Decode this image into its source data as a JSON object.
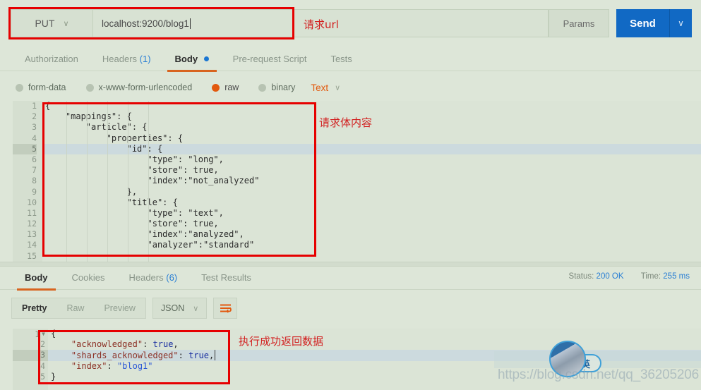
{
  "request_bar": {
    "method": "PUT",
    "method_caret": "∨",
    "url_value": "localhost:9200/blog1",
    "params_label": "Params",
    "send_label": "Send",
    "send_caret": "∨",
    "annotation": "请求url"
  },
  "request_tabs": [
    {
      "label": "Authorization",
      "active": false
    },
    {
      "label": "Headers",
      "count": "(1)",
      "active": false
    },
    {
      "label": "Body",
      "dot": true,
      "active": true
    },
    {
      "label": "Pre-request Script",
      "active": false
    },
    {
      "label": "Tests",
      "active": false
    }
  ],
  "body_types": [
    {
      "label": "form-data",
      "selected": false
    },
    {
      "label": "x-www-form-urlencoded",
      "selected": false
    },
    {
      "label": "raw",
      "selected": true
    },
    {
      "label": "binary",
      "selected": false
    }
  ],
  "body_format": {
    "label": "Text",
    "caret": "∨"
  },
  "request_body": {
    "annotation": "请求体内容",
    "active_line": 5,
    "lines": [
      "{",
      "    \"mappings\": {",
      "        \"article\": {",
      "            \"properties\": {",
      "                \"id\": {",
      "                    \"type\": \"long\",",
      "                    \"store\": true,",
      "                    \"index\":\"not_analyzed\"",
      "                },",
      "                \"title\": {",
      "                    \"type\": \"text\",",
      "                    \"store\": true,",
      "                    \"index\":\"analyzed\",",
      "                    \"analyzer\":\"standard\""
    ],
    "line_numbers": [
      "1",
      "2",
      "3",
      "4",
      "5",
      "6",
      "7",
      "8",
      "9",
      "10",
      "11",
      "12",
      "13",
      "14"
    ]
  },
  "response_tabs": [
    {
      "label": "Body",
      "active": true
    },
    {
      "label": "Cookies",
      "active": false
    },
    {
      "label": "Headers",
      "count": "(6)",
      "active": false
    },
    {
      "label": "Test Results",
      "active": false
    }
  ],
  "response_status": {
    "status_label": "Status:",
    "status_value": "200 OK",
    "time_label": "Time:",
    "time_value": "255 ms"
  },
  "response_toolbar": {
    "views": [
      {
        "label": "Pretty",
        "active": true
      },
      {
        "label": "Raw",
        "active": false
      },
      {
        "label": "Preview",
        "active": false
      }
    ],
    "format": "JSON",
    "format_caret": "∨",
    "wrap_icon": "word-wrap-icon"
  },
  "response_body": {
    "annotation": "执行成功返回数据",
    "active_line": 3,
    "line_numbers": [
      "1",
      "2",
      "3",
      "4",
      "5"
    ],
    "lines": [
      {
        "indent": "",
        "parts": [
          {
            "t": "{",
            "c": "plain"
          }
        ]
      },
      {
        "indent": "    ",
        "parts": [
          {
            "t": "\"acknowledged\"",
            "c": "k"
          },
          {
            "t": ": ",
            "c": "plain"
          },
          {
            "t": "true",
            "c": "bool"
          },
          {
            "t": ",",
            "c": "plain"
          }
        ]
      },
      {
        "indent": "    ",
        "parts": [
          {
            "t": "\"shards_acknowledged\"",
            "c": "k"
          },
          {
            "t": ": ",
            "c": "plain"
          },
          {
            "t": "true",
            "c": "bool"
          },
          {
            "t": ",",
            "c": "plain"
          }
        ]
      },
      {
        "indent": "    ",
        "parts": [
          {
            "t": "\"index\"",
            "c": "k"
          },
          {
            "t": ": ",
            "c": "plain"
          },
          {
            "t": "\"blog1\"",
            "c": "str"
          }
        ]
      },
      {
        "indent": "",
        "parts": [
          {
            "t": "}",
            "c": "plain"
          }
        ]
      }
    ]
  },
  "watermark": {
    "url": "https://blog.csdn.net/qq_36205206",
    "badge_text": "英"
  },
  "colors": {
    "background": "#dde6d8",
    "accent_orange": "#d8641f",
    "accent_blue": "#1169c4",
    "annotation_red": "#d22020",
    "redbox": "#e60000"
  }
}
